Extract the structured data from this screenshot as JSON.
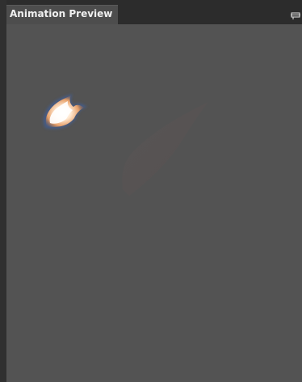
{
  "panel": {
    "title": "Animation Preview"
  },
  "icons": {
    "panel_menu": "panel-menu-icon",
    "flame_sprite": "flame-sprite",
    "shadow_sprite": "shadow-sprite"
  },
  "colors": {
    "viewport_bg": "#535353",
    "tab_bg": "#4d4d4d",
    "tab_bar_bg": "#2c2c2c",
    "flame_core": "#fff5e6",
    "flame_outer": "#c87840",
    "flame_glow": "#5a7ab8"
  }
}
